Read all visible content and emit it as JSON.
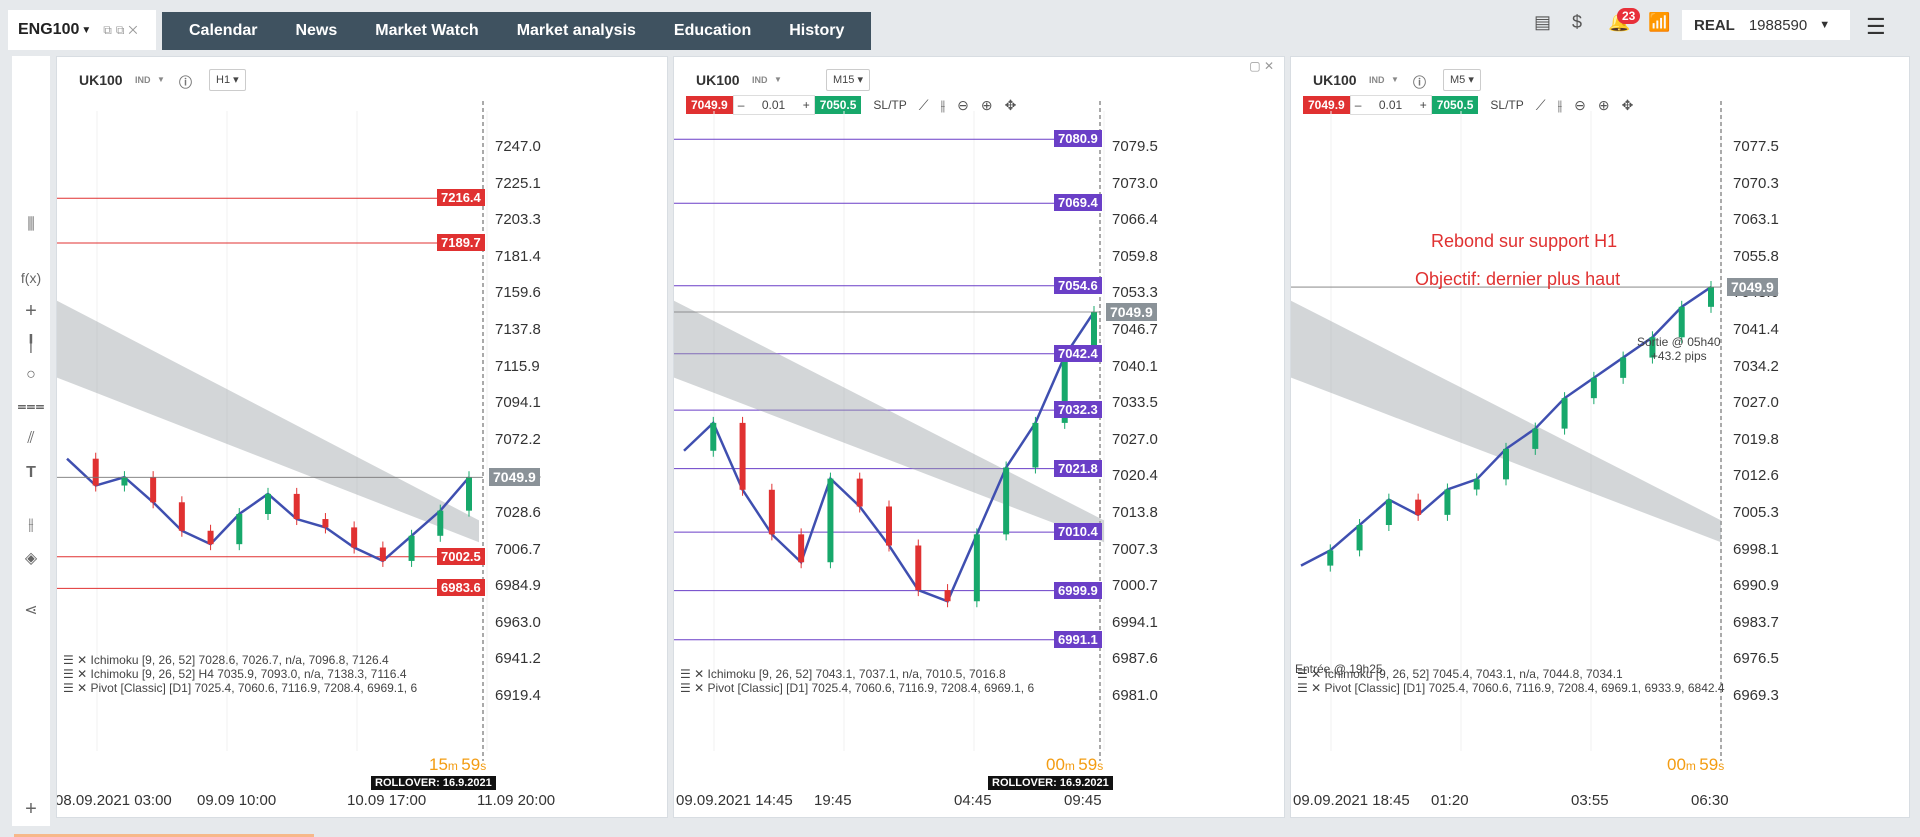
{
  "topbar": {
    "instrument": "ENG100",
    "nav": [
      "Calendar",
      "News",
      "Market Watch",
      "Market analysis",
      "Education",
      "History"
    ],
    "notifications": "23",
    "account_type": "REAL",
    "account_number": "1988590"
  },
  "left_toolbar": {
    "tools": [
      "bars-icon",
      "function-icon",
      "crosshair-icon",
      "pen-icon",
      "circle-icon",
      "fibonacci-icon",
      "lines-icon",
      "text-icon",
      "indicators-icon",
      "layers-icon",
      "share-icon",
      "add-icon"
    ]
  },
  "colors": {
    "sell": "#e03131",
    "buy": "#17a86b",
    "cloud": "#9ea4a8",
    "purple": "#6a3fc7",
    "blue": "#3f4fb0",
    "red_level": "#e03131"
  },
  "panels": [
    {
      "symbol": "UK100",
      "tag": "IND",
      "timeframe": "H1",
      "price_axis": [
        "7247.0",
        "7225.1",
        "7203.3",
        "7181.4",
        "7159.6",
        "7137.8",
        "7115.9",
        "7094.1",
        "7072.2",
        "7050.4",
        "7028.6",
        "7006.7",
        "6984.9",
        "6963.0",
        "6941.2",
        "6919.4"
      ],
      "level_labels": [
        {
          "value": "7216.4",
          "color": "#e03131"
        },
        {
          "value": "7189.7",
          "color": "#e03131"
        },
        {
          "value": "7002.5",
          "color": "#e03131"
        },
        {
          "value": "6983.6",
          "color": "#e03131"
        }
      ],
      "current_price": "7049.9",
      "time_axis": [
        "08.09.2021 03:00",
        "09.09 10:00",
        "10.09 17:00",
        "11.09 20:00"
      ],
      "legend": [
        "Ichimoku [9, 26, 52] 7028.6, 7026.7, n/a, 7096.8, 7126.4",
        "Ichimoku [9, 26, 52] H4 7035.9, 7093.0, n/a, 7138.3, 7116.4",
        "Pivot [Classic] [D1] 7025.4, 7060.6, 7116.9, 7208.4, 6969.1, 6"
      ],
      "rollover": "ROLLOVER: 16.9.2021",
      "countdown_min": "15",
      "countdown_sec": "59",
      "chart_data": {
        "type": "line",
        "x": [
          "08.09.2021 03:00",
          "09.09 10:00",
          "10.09 17:00",
          "11.09 20:00"
        ],
        "ylim": [
          6919.4,
          7247.0
        ],
        "series": [
          {
            "values": [
              7061,
              7045,
              7050,
              7035,
              7018,
              7010,
              7028,
              7040,
              7025,
              7020,
              7008,
              7000,
              7015,
              7030,
              7049.9
            ]
          }
        ]
      }
    },
    {
      "symbol": "UK100",
      "tag": "IND",
      "timeframe": "M15",
      "sell_price": "7049.9",
      "qty": "0.01",
      "buy_price": "7050.5",
      "sltp": "SL/TP",
      "price_axis": [
        "7079.5",
        "7073.0",
        "7066.4",
        "7059.8",
        "7053.3",
        "7046.7",
        "7040.1",
        "7033.5",
        "7027.0",
        "7020.4",
        "7013.8",
        "7007.3",
        "7000.7",
        "6994.1",
        "6987.6",
        "6981.0"
      ],
      "level_labels": [
        {
          "value": "7080.9",
          "color": "#6a3fc7"
        },
        {
          "value": "7069.4",
          "color": "#6a3fc7"
        },
        {
          "value": "7054.6",
          "color": "#6a3fc7"
        },
        {
          "value": "7042.4",
          "color": "#6a3fc7"
        },
        {
          "value": "7032.3",
          "color": "#6a3fc7"
        },
        {
          "value": "7021.8",
          "color": "#6a3fc7"
        },
        {
          "value": "7010.4",
          "color": "#6a3fc7"
        },
        {
          "value": "6999.9",
          "color": "#6a3fc7"
        },
        {
          "value": "6991.1",
          "color": "#6a3fc7"
        }
      ],
      "current_price": "7049.9",
      "time_axis": [
        "09.09.2021 14:45",
        "19:45",
        "04:45",
        "09:45"
      ],
      "legend": [
        "Ichimoku [9, 26, 52] 7043.1, 7037.1, n/a, 7010.5, 7016.8",
        "Pivot [Classic] [D1] 7025.4, 7060.6, 7116.9, 7208.4, 6969.1, 6"
      ],
      "rollover": "ROLLOVER: 16.9.2021",
      "countdown_min": "00",
      "countdown_sec": "59",
      "chart_data": {
        "type": "line",
        "x": [
          "09.09.2021 14:45",
          "19:45",
          "04:45",
          "09:45"
        ],
        "ylim": [
          6981.0,
          7079.5
        ],
        "series": [
          {
            "values": [
              7025,
              7030,
              7018,
              7010,
              7005,
              7020,
              7015,
              7008,
              7000,
              6998,
              7010,
              7022,
              7030,
              7042,
              7049.9
            ]
          }
        ]
      }
    },
    {
      "symbol": "UK100",
      "tag": "IND",
      "timeframe": "M5",
      "sell_price": "7049.9",
      "qty": "0.01",
      "buy_price": "7050.5",
      "sltp": "SL/TP",
      "price_axis": [
        "7077.5",
        "7070.3",
        "7063.1",
        "7055.8",
        "7048.6",
        "7041.4",
        "7034.2",
        "7027.0",
        "7019.8",
        "7012.6",
        "7005.3",
        "6998.1",
        "6990.9",
        "6983.7",
        "6976.5",
        "6969.3"
      ],
      "level_labels": [],
      "current_price": "7049.9",
      "annotations": [
        "Rebond sur support H1",
        "Objectif: dernier plus haut"
      ],
      "exit_note": [
        "Sortie @ 05h40",
        "+43.2 pips"
      ],
      "entry_note": "Entrée @ 19h25",
      "time_axis": [
        "09.09.2021 18:45",
        "01:20",
        "03:55",
        "06:30"
      ],
      "legend": [
        "Ichimoku [9, 26, 52] 7045.4, 7043.1, n/a, 7044.8, 7034.1",
        "Pivot [Classic] [D1] 7025.4, 7060.6, 7116.9, 7208.4, 6969.1, 6933.9, 6842.4"
      ],
      "countdown_min": "00",
      "countdown_sec": "59",
      "chart_data": {
        "type": "line",
        "x": [
          "09.09.2021 18:45",
          "01:20",
          "03:55",
          "06:30"
        ],
        "ylim": [
          6969.3,
          7077.5
        ],
        "series": [
          {
            "values": [
              6995,
              6998,
              7003,
              7008,
              7005,
              7010,
              7012,
              7018,
              7022,
              7028,
              7032,
              7036,
              7040,
              7046,
              7049.9
            ]
          }
        ]
      }
    }
  ]
}
